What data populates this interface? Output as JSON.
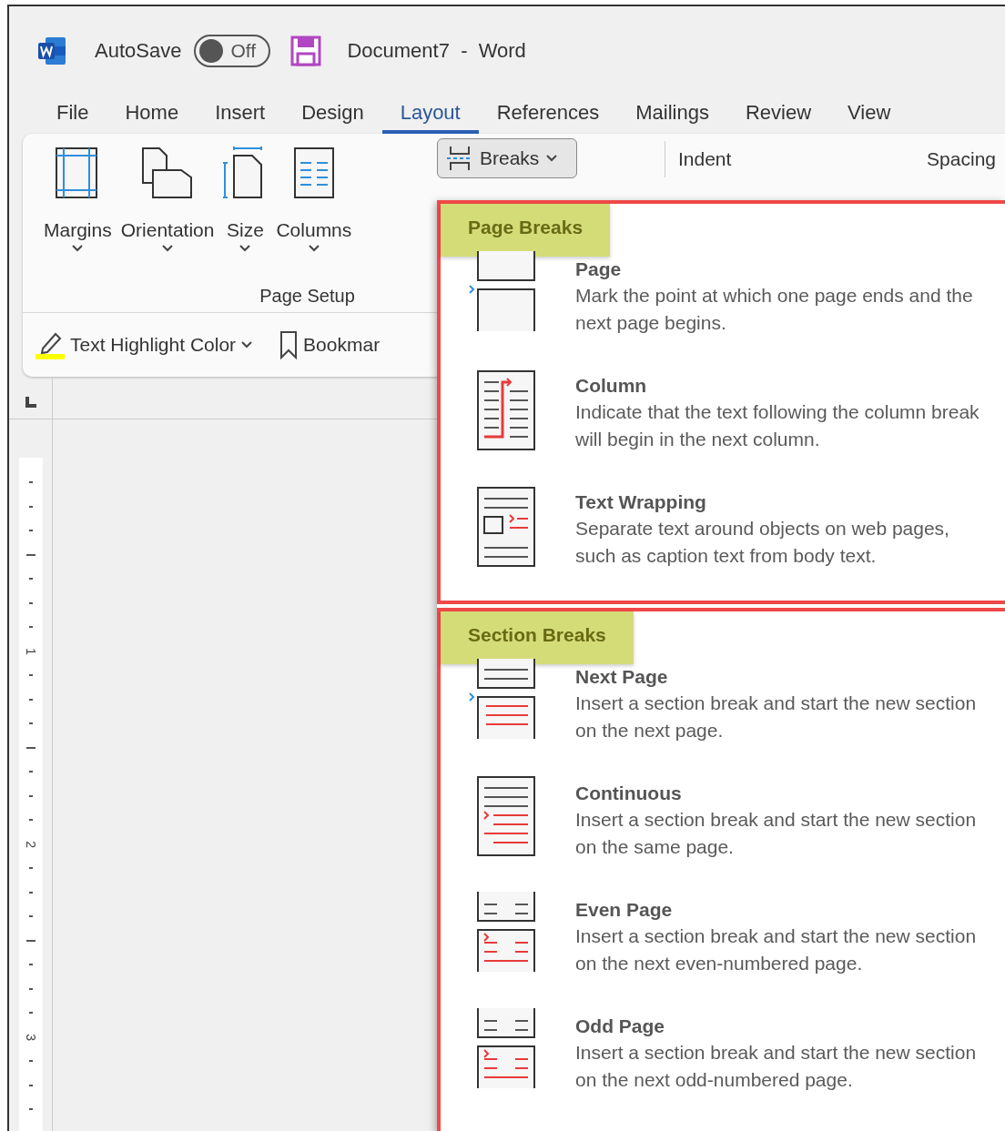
{
  "title_bar": {
    "autosave_label": "AutoSave",
    "autosave": {
      "on": false,
      "label": "Off"
    },
    "document_title": "Document7  -  Word"
  },
  "ribbon_tabs": [
    {
      "label": "File",
      "selected": false
    },
    {
      "label": "Home",
      "selected": false
    },
    {
      "label": "Insert",
      "selected": false
    },
    {
      "label": "Design",
      "selected": false
    },
    {
      "label": "Layout",
      "selected": true
    },
    {
      "label": "References",
      "selected": false
    },
    {
      "label": "Mailings",
      "selected": false
    },
    {
      "label": "Review",
      "selected": false
    },
    {
      "label": "View",
      "selected": false
    }
  ],
  "ribbon": {
    "page_setup": {
      "label": "Page Setup",
      "buttons": [
        {
          "label": "Margins",
          "kind": "margins"
        },
        {
          "label": "Orientation",
          "kind": "orientation"
        },
        {
          "label": "Size",
          "kind": "size"
        },
        {
          "label": "Columns",
          "kind": "columns"
        }
      ]
    },
    "breaks_button": {
      "label": "Breaks"
    },
    "paragraph_labels": [
      "Indent",
      "Spacing"
    ],
    "second_row": [
      {
        "label": "Text Highlight Color",
        "kind": "highlight"
      },
      {
        "label": "Bookmar",
        "kind": "bookmark"
      }
    ]
  },
  "ruler": {
    "labels": [
      "1",
      "2",
      "3"
    ]
  },
  "breaks_menu": {
    "sections": [
      {
        "heading": "Page Breaks",
        "items": [
          {
            "title": "Page",
            "description": "Mark the point at which one page ends and the next page begins.",
            "kind": "page"
          },
          {
            "title": "Column",
            "description": "Indicate that the text following the column break will begin in the next column.",
            "kind": "column"
          },
          {
            "title": "Text Wrapping",
            "description": "Separate text around objects on web pages, such as caption text from body text.",
            "kind": "wrapping"
          }
        ]
      },
      {
        "heading": "Section Breaks",
        "items": [
          {
            "title": "Next Page",
            "description": "Insert a section break and start the new section on the next page.",
            "kind": "next"
          },
          {
            "title": "Continuous",
            "description": "Insert a section break and start the new section on the same page.",
            "kind": "continuous"
          },
          {
            "title": "Even Page",
            "description": "Insert a section break and start the new section on the next even-numbered page.",
            "kind": "even"
          },
          {
            "title": "Odd Page",
            "description": "Insert a section break and start the new section on the next odd-numbered page.",
            "kind": "odd"
          }
        ]
      }
    ]
  }
}
